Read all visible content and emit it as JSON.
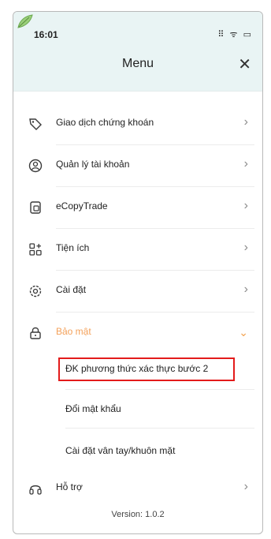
{
  "status_bar": {
    "time": "16:01",
    "icons_text": "⠿ ᯤ ▭"
  },
  "header": {
    "title": "Menu",
    "close_glyph": "✕"
  },
  "menu": {
    "items": [
      {
        "label": "Giao dịch chứng khoán",
        "icon": "tag-icon"
      },
      {
        "label": "Quản lý tài khoản",
        "icon": "user-circle-icon"
      },
      {
        "label": "eCopyTrade",
        "icon": "copy-document-icon"
      },
      {
        "label": "Tiện ích",
        "icon": "grid-plus-icon"
      },
      {
        "label": "Cài đặt",
        "icon": "gear-icon"
      },
      {
        "label": "Bảo mật",
        "icon": "lock-icon",
        "expanded": true
      },
      {
        "label": "Hỗ trợ",
        "icon": "headset-icon"
      }
    ],
    "security_sub_items": [
      {
        "label": "ĐK phương thức xác thực bước 2",
        "highlighted": true
      },
      {
        "label": "Đổi mật khẩu"
      },
      {
        "label": "Cài đặt vân tay/khuôn mặt"
      }
    ]
  },
  "footer": {
    "version": "Version: 1.0.2"
  },
  "colors": {
    "header_bg": "#e9f4f4",
    "active_text": "#f4a15a",
    "highlight_border": "#e31b1b"
  }
}
